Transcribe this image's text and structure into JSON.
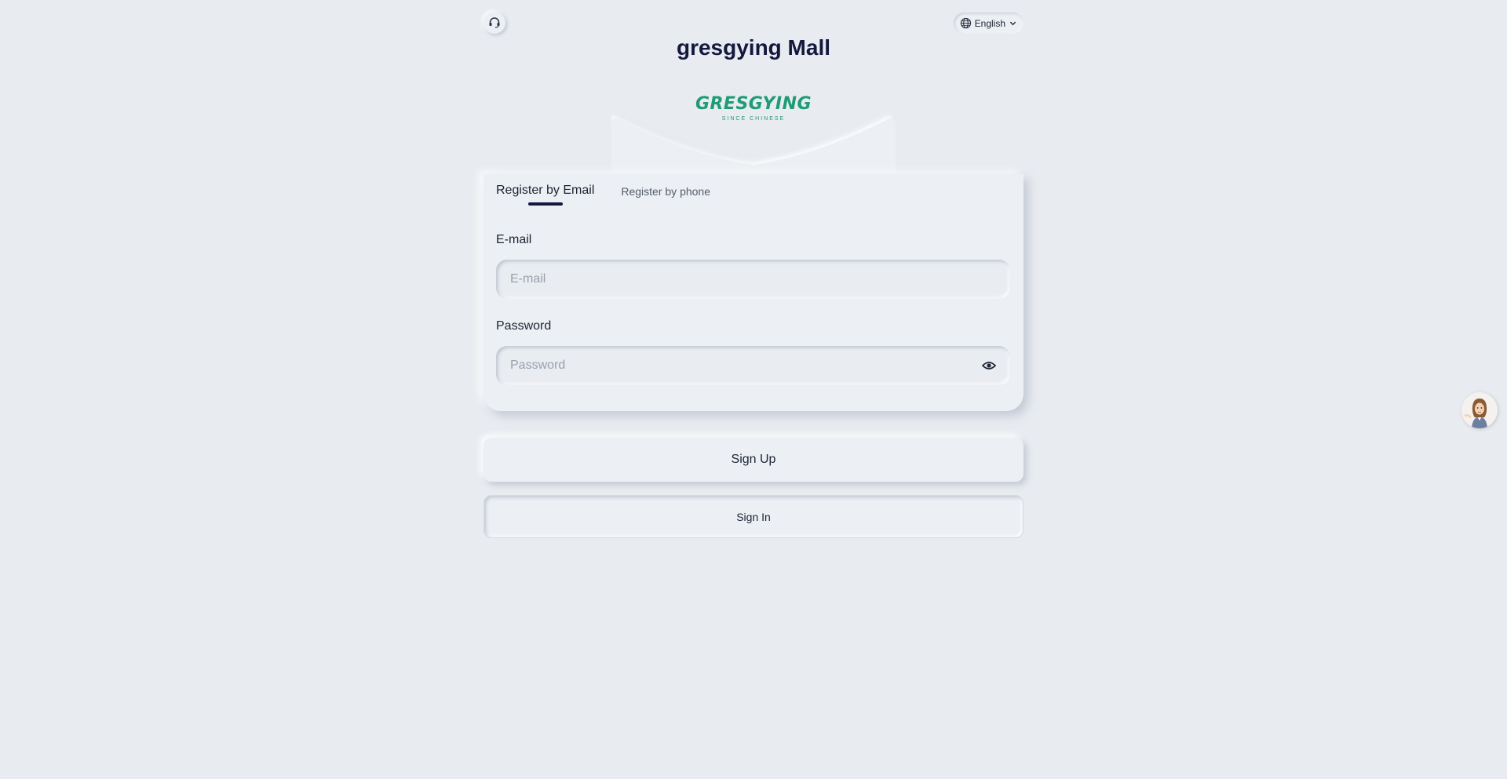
{
  "header": {
    "support_icon": "headset-icon",
    "language": {
      "label": "English",
      "icon": "globe-icon",
      "caret_icon": "chevron-down-icon"
    },
    "title": "gresgying Mall"
  },
  "logo": {
    "text": "GRESGYING",
    "sub": "SINCE CHINESE"
  },
  "register": {
    "tabs": [
      {
        "label": "Register by Email",
        "active": true
      },
      {
        "label": "Register by phone",
        "active": false
      }
    ],
    "email": {
      "label": "E-mail",
      "placeholder": "E-mail",
      "value": ""
    },
    "password": {
      "label": "Password",
      "placeholder": "Password",
      "value": "",
      "toggle_icon": "eye-icon"
    }
  },
  "actions": {
    "signup_label": "Sign Up",
    "signin_label": "Sign In"
  },
  "assistant": {
    "icon": "assistant-avatar-icon"
  },
  "colors": {
    "background": "#e8ebf0",
    "title": "#14183d",
    "brand": "#1f9c74",
    "tab_indicator": "#14183d"
  }
}
